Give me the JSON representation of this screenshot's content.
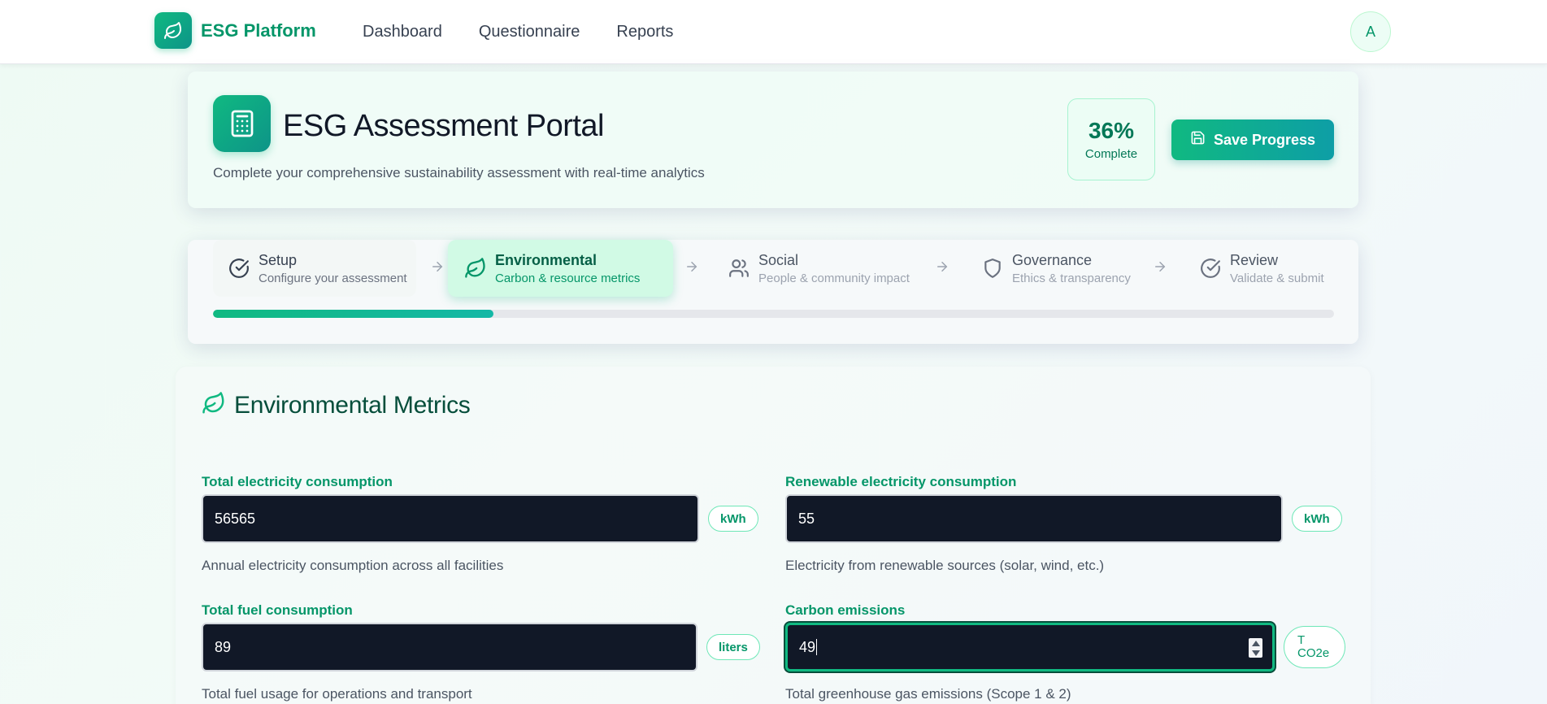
{
  "nav": {
    "brand": "ESG Platform",
    "links": [
      "Dashboard",
      "Questionnaire",
      "Reports"
    ],
    "avatar_initial": "A"
  },
  "header": {
    "title": "ESG Assessment Portal",
    "subtitle": "Complete your comprehensive sustainability assessment with real-time analytics",
    "completion_value": "36%",
    "completion_label": "Complete",
    "save_label": "Save Progress"
  },
  "stepper": {
    "steps": [
      {
        "title": "Setup",
        "desc": "Configure your assessment",
        "state": "done"
      },
      {
        "title": "Environmental",
        "desc": "Carbon & resource metrics",
        "state": "active"
      },
      {
        "title": "Social",
        "desc": "People & community impact",
        "state": "pending"
      },
      {
        "title": "Governance",
        "desc": "Ethics & transparency",
        "state": "pending"
      },
      {
        "title": "Review",
        "desc": "Validate & submit",
        "state": "pending"
      }
    ],
    "progress_fraction": 0.25
  },
  "metrics": {
    "title": "Environmental Metrics",
    "fields": [
      {
        "label": "Total electricity consumption",
        "value": "56565",
        "unit": "kWh",
        "help": "Annual electricity consumption across all facilities"
      },
      {
        "label": "Renewable electricity consumption",
        "value": "55",
        "unit": "kWh",
        "help": "Electricity from renewable sources (solar, wind, etc.)"
      },
      {
        "label": "Total fuel consumption",
        "value": "89",
        "unit": "liters",
        "help": "Total fuel usage for operations and transport"
      },
      {
        "label": "Carbon emissions",
        "value": "49",
        "unit": "T CO2e",
        "help": "Total greenhouse gas emissions (Scope 1 & 2)"
      }
    ]
  },
  "colors": {
    "accent": "#10b981",
    "accent_dark": "#059669",
    "input_bg": "#111827"
  }
}
